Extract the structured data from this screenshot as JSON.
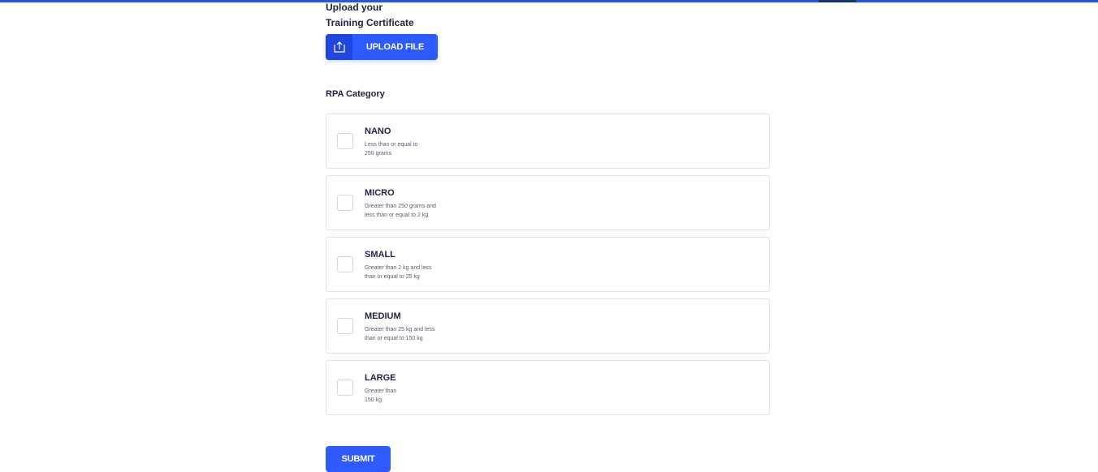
{
  "upload": {
    "title_line1": "Upload your",
    "title_line2": "Training Certificate",
    "button_label": "UPLOAD FILE",
    "button_icon": "upload-icon"
  },
  "rpa": {
    "section_label": "RPA Category",
    "categories": [
      {
        "name": "NANO",
        "desc_line1": "Less than or equal to",
        "desc_line2": "250 grams",
        "checked": false
      },
      {
        "name": "MICRO",
        "desc_line1": "Greater than 250 grams and",
        "desc_line2": "less than or equal to 2 kg",
        "checked": false
      },
      {
        "name": "SMALL",
        "desc_line1": "Greater than 2 kg and less",
        "desc_line2": "than or equal to 25 kg",
        "checked": false
      },
      {
        "name": "MEDIUM",
        "desc_line1": "Greater than 25 kg and less",
        "desc_line2": "than or equal to 150 kg",
        "checked": false
      },
      {
        "name": "LARGE",
        "desc_line1": "Greater than",
        "desc_line2": "150 kg",
        "checked": false
      }
    ]
  },
  "submit_label": "SUBMIT",
  "colors": {
    "primary": "#2d5bff",
    "primary_dark": "#1f47e0",
    "text": "#1f2340",
    "border": "#e3e5ea"
  }
}
